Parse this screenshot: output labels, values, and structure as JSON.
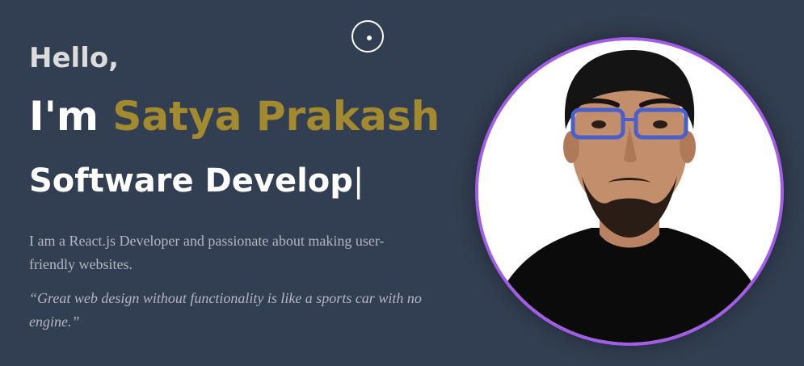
{
  "hero": {
    "greeting": "Hello,",
    "name_prefix": "I'm ",
    "name": "Satya Prakash",
    "role_typed": "Software Develop",
    "caret": "|",
    "bio": "I am a React.js Developer and passionate about making user-friendly websites.",
    "quote": "“Great web design without functionality is like a sports car with no engine.”"
  },
  "colors": {
    "background": "#323e51",
    "accent_name": "#a38a2f",
    "avatar_border": "#a35ce8",
    "heading": "#ffffff",
    "body_text": "#b3b7c1"
  },
  "icons": {
    "cursor": "custom-cursor-icon",
    "avatar": "profile-photo"
  }
}
